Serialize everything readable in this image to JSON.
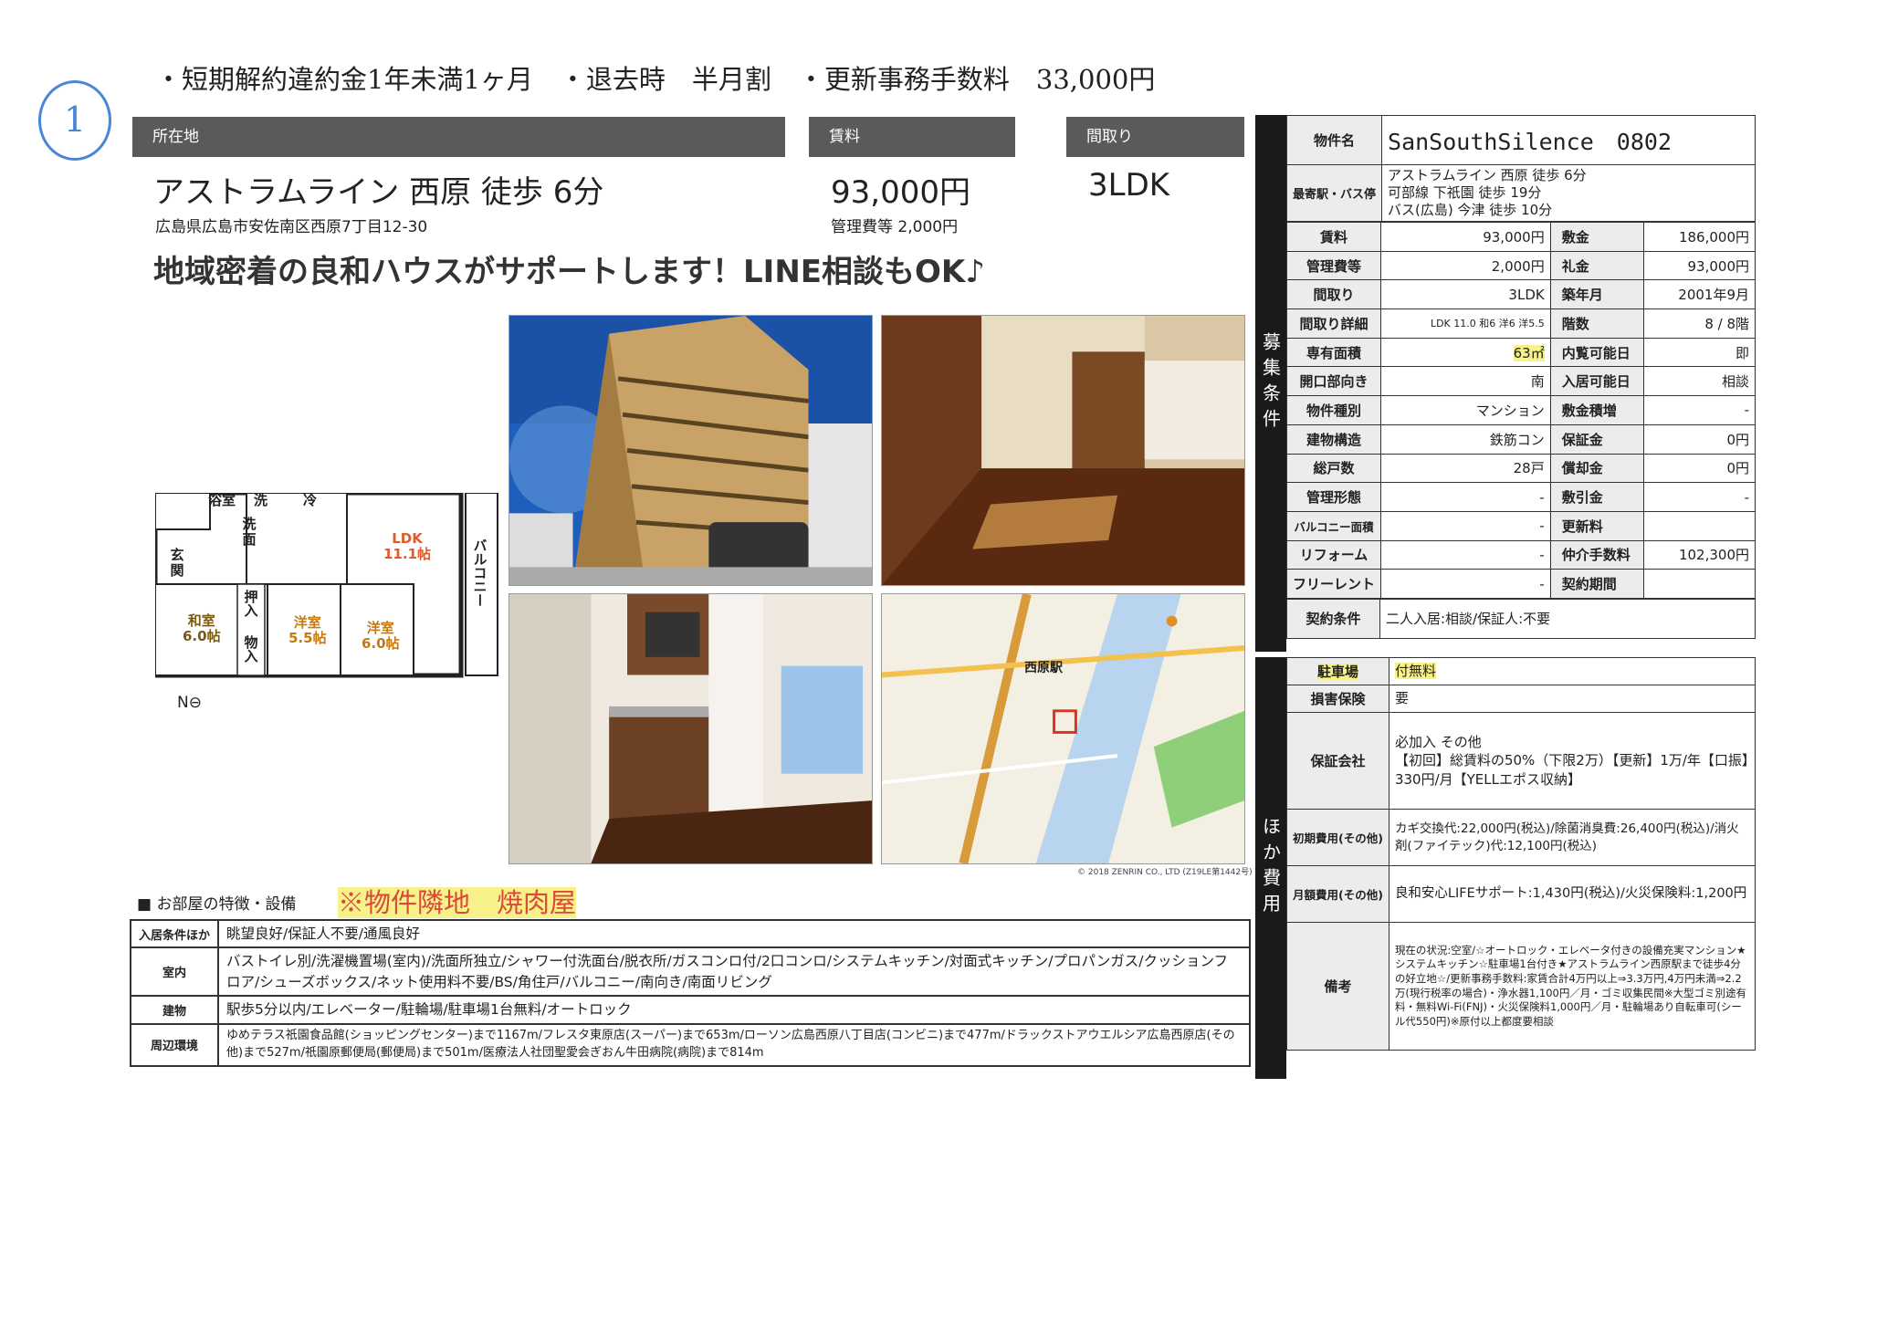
{
  "hand_mark": "1",
  "notes": "・短期解約違約金1年未満1ヶ月　・退去時　半月割　・更新事務手数料　33,000円",
  "location": {
    "header": "所在地",
    "station": "アストラムライン 西原 徒歩 6分",
    "address": "広島県広島市安佐南区西原7丁目12-30"
  },
  "rent": {
    "header": "賃料",
    "value": "93,000円",
    "fee": "管理費等 2,000円"
  },
  "layout": {
    "header": "間取り",
    "value": "3LDK"
  },
  "slogan": "地域密着の良和ハウスがサポートします！LINE相談もOK♪",
  "floorplan": {
    "rooms": {
      "bath": "浴室",
      "wash1": "洗",
      "wash2": "洗面",
      "toilet": "〒",
      "reizo": "冷",
      "genkan": "玄関",
      "ldk": "LDK\n11.1帖",
      "balcony": "バルコニー",
      "washitsu": "和室\n6.0帖",
      "oshiire": "押入",
      "monoire": "物入",
      "yoshitsu1": "洋室\n5.5帖",
      "yoshitsu2": "洋室\n6.0帖"
    },
    "compass": "N"
  },
  "map": {
    "station_label": "西原駅",
    "copyright": "© 2018 ZENRIN CO., LTD (Z19LE第1442号)"
  },
  "features": {
    "heading": "■ お部屋の特徴・設備",
    "handwritten": "※物件隣地　焼肉屋",
    "rows": [
      {
        "key": "入居条件ほか",
        "value": "眺望良好/保証人不要/通風良好"
      },
      {
        "key": "室内",
        "value": "バストイレ別/洗濯機置場(室内)/洗面所独立/シャワー付洗面台/脱衣所/ガスコンロ付/2口コンロ/システムキッチン/対面式キッチン/プロパンガス/クッションフロア/シューズボックス/ネット使用料不要/BS/角住戸/バルコニー/南向き/南面リビング"
      },
      {
        "key": "建物",
        "value": "駅歩5分以内/エレベーター/駐輪場/駐車場1台無料/オートロック"
      },
      {
        "key": "周辺環境",
        "value": "ゆめテラス祇園食品館(ショッピングセンター)まで1167m/フレスタ東原店(スーパー)まで653m/ローソン広島西原八丁目店(コンビニ)まで477m/ドラックストアウエルシア広島西原店(その他)まで527m/祇園原郵便局(郵便局)まで501m/医療法人社団聖愛会ぎおん牛田病院(病院)まで814m"
      }
    ]
  },
  "panel": {
    "band_top": "募集条件",
    "band_bottom": "ほか費用",
    "property_name_key": "物件名",
    "property_name": "SanSouthSilence　0802",
    "station_key": "最寄駅・バス停",
    "station_lines": [
      "アストラムライン 西原 徒歩 6分",
      "可部線 下祇園 徒歩 19分",
      "バス(広島) 今津 徒歩 10分"
    ],
    "rows": [
      [
        "賃料",
        "93,000円",
        "敷金",
        "186,000円"
      ],
      [
        "管理費等",
        "2,000円",
        "礼金",
        "93,000円"
      ],
      [
        "間取り",
        "3LDK",
        "築年月",
        "2001年9月"
      ],
      [
        "間取り詳細",
        "LDK 11.0 和6 洋6 洋5.5",
        "階数",
        "8 / 8階"
      ],
      [
        "専有面積",
        "63㎡",
        "内覧可能日",
        "即"
      ],
      [
        "開口部向き",
        "南",
        "入居可能日",
        "相談"
      ],
      [
        "物件種別",
        "マンション",
        "敷金積増",
        "-"
      ],
      [
        "建物構造",
        "鉄筋コン",
        "保証金",
        "0円"
      ],
      [
        "総戸数",
        "28戸",
        "償却金",
        "0円"
      ],
      [
        "管理形態",
        "-",
        "敷引金",
        "-"
      ],
      [
        "バルコニー面積",
        "-",
        "更新料",
        ""
      ],
      [
        "リフォーム",
        "-",
        "仲介手数料",
        "102,300円"
      ],
      [
        "フリーレント",
        "-",
        "契約期間",
        ""
      ]
    ],
    "contract_key": "契約条件",
    "contract_value": "二人入居:相談/保証人:不要",
    "other_rows": [
      {
        "key": "駐車場",
        "value": "付無料"
      },
      {
        "key": "損害保険",
        "value": "要"
      },
      {
        "key": "保証会社",
        "value": "必加入 その他\n【初回】総賃料の50%（下限2万）【更新】1万/年【口振】330円/月【YELLエポス収納】"
      },
      {
        "key": "初期費用(その他)",
        "value": "カギ交換代:22,000円(税込)/除菌消臭費:26,400円(税込)/消火剤(ファイテック)代:12,100円(税込)"
      },
      {
        "key": "月額費用(その他)",
        "value": "良和安心LIFEサポート:1,430円(税込)/火災保険料:1,200円"
      },
      {
        "key": "備考",
        "value": "現在の状況:空室/☆オートロック・エレベータ付きの設備充実マンション★システムキッチン☆駐車場1台付き★アストラムライン西原駅まで徒歩4分の好立地☆/更新事務手数料:家賃合計4万円以上⇒3.3万円,4万円未満⇒2.2万(現行税率の場合)・浄水器1,100円／月・ゴミ収集民間※大型ゴミ別途有料・無料Wi-Fi(FNJ)・火災保険料1,000円／月・駐輪場あり自転車可(シール代550円)※原付以上都度要相談"
      }
    ]
  }
}
